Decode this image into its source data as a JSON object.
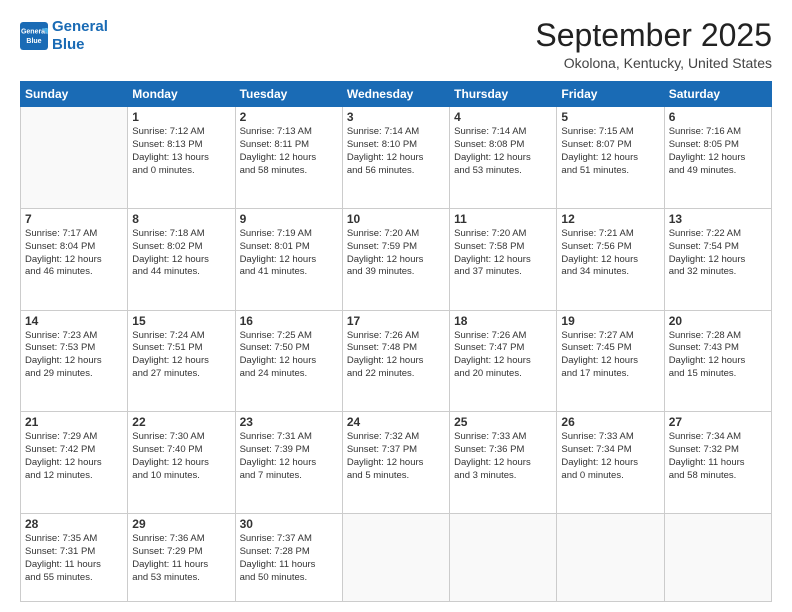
{
  "header": {
    "logo_line1": "General",
    "logo_line2": "Blue",
    "title": "September 2025",
    "subtitle": "Okolona, Kentucky, United States"
  },
  "weekdays": [
    "Sunday",
    "Monday",
    "Tuesday",
    "Wednesday",
    "Thursday",
    "Friday",
    "Saturday"
  ],
  "weeks": [
    [
      {
        "day": "",
        "info": ""
      },
      {
        "day": "1",
        "info": "Sunrise: 7:12 AM\nSunset: 8:13 PM\nDaylight: 13 hours\nand 0 minutes."
      },
      {
        "day": "2",
        "info": "Sunrise: 7:13 AM\nSunset: 8:11 PM\nDaylight: 12 hours\nand 58 minutes."
      },
      {
        "day": "3",
        "info": "Sunrise: 7:14 AM\nSunset: 8:10 PM\nDaylight: 12 hours\nand 56 minutes."
      },
      {
        "day": "4",
        "info": "Sunrise: 7:14 AM\nSunset: 8:08 PM\nDaylight: 12 hours\nand 53 minutes."
      },
      {
        "day": "5",
        "info": "Sunrise: 7:15 AM\nSunset: 8:07 PM\nDaylight: 12 hours\nand 51 minutes."
      },
      {
        "day": "6",
        "info": "Sunrise: 7:16 AM\nSunset: 8:05 PM\nDaylight: 12 hours\nand 49 minutes."
      }
    ],
    [
      {
        "day": "7",
        "info": "Sunrise: 7:17 AM\nSunset: 8:04 PM\nDaylight: 12 hours\nand 46 minutes."
      },
      {
        "day": "8",
        "info": "Sunrise: 7:18 AM\nSunset: 8:02 PM\nDaylight: 12 hours\nand 44 minutes."
      },
      {
        "day": "9",
        "info": "Sunrise: 7:19 AM\nSunset: 8:01 PM\nDaylight: 12 hours\nand 41 minutes."
      },
      {
        "day": "10",
        "info": "Sunrise: 7:20 AM\nSunset: 7:59 PM\nDaylight: 12 hours\nand 39 minutes."
      },
      {
        "day": "11",
        "info": "Sunrise: 7:20 AM\nSunset: 7:58 PM\nDaylight: 12 hours\nand 37 minutes."
      },
      {
        "day": "12",
        "info": "Sunrise: 7:21 AM\nSunset: 7:56 PM\nDaylight: 12 hours\nand 34 minutes."
      },
      {
        "day": "13",
        "info": "Sunrise: 7:22 AM\nSunset: 7:54 PM\nDaylight: 12 hours\nand 32 minutes."
      }
    ],
    [
      {
        "day": "14",
        "info": "Sunrise: 7:23 AM\nSunset: 7:53 PM\nDaylight: 12 hours\nand 29 minutes."
      },
      {
        "day": "15",
        "info": "Sunrise: 7:24 AM\nSunset: 7:51 PM\nDaylight: 12 hours\nand 27 minutes."
      },
      {
        "day": "16",
        "info": "Sunrise: 7:25 AM\nSunset: 7:50 PM\nDaylight: 12 hours\nand 24 minutes."
      },
      {
        "day": "17",
        "info": "Sunrise: 7:26 AM\nSunset: 7:48 PM\nDaylight: 12 hours\nand 22 minutes."
      },
      {
        "day": "18",
        "info": "Sunrise: 7:26 AM\nSunset: 7:47 PM\nDaylight: 12 hours\nand 20 minutes."
      },
      {
        "day": "19",
        "info": "Sunrise: 7:27 AM\nSunset: 7:45 PM\nDaylight: 12 hours\nand 17 minutes."
      },
      {
        "day": "20",
        "info": "Sunrise: 7:28 AM\nSunset: 7:43 PM\nDaylight: 12 hours\nand 15 minutes."
      }
    ],
    [
      {
        "day": "21",
        "info": "Sunrise: 7:29 AM\nSunset: 7:42 PM\nDaylight: 12 hours\nand 12 minutes."
      },
      {
        "day": "22",
        "info": "Sunrise: 7:30 AM\nSunset: 7:40 PM\nDaylight: 12 hours\nand 10 minutes."
      },
      {
        "day": "23",
        "info": "Sunrise: 7:31 AM\nSunset: 7:39 PM\nDaylight: 12 hours\nand 7 minutes."
      },
      {
        "day": "24",
        "info": "Sunrise: 7:32 AM\nSunset: 7:37 PM\nDaylight: 12 hours\nand 5 minutes."
      },
      {
        "day": "25",
        "info": "Sunrise: 7:33 AM\nSunset: 7:36 PM\nDaylight: 12 hours\nand 3 minutes."
      },
      {
        "day": "26",
        "info": "Sunrise: 7:33 AM\nSunset: 7:34 PM\nDaylight: 12 hours\nand 0 minutes."
      },
      {
        "day": "27",
        "info": "Sunrise: 7:34 AM\nSunset: 7:32 PM\nDaylight: 11 hours\nand 58 minutes."
      }
    ],
    [
      {
        "day": "28",
        "info": "Sunrise: 7:35 AM\nSunset: 7:31 PM\nDaylight: 11 hours\nand 55 minutes."
      },
      {
        "day": "29",
        "info": "Sunrise: 7:36 AM\nSunset: 7:29 PM\nDaylight: 11 hours\nand 53 minutes."
      },
      {
        "day": "30",
        "info": "Sunrise: 7:37 AM\nSunset: 7:28 PM\nDaylight: 11 hours\nand 50 minutes."
      },
      {
        "day": "",
        "info": ""
      },
      {
        "day": "",
        "info": ""
      },
      {
        "day": "",
        "info": ""
      },
      {
        "day": "",
        "info": ""
      }
    ]
  ]
}
